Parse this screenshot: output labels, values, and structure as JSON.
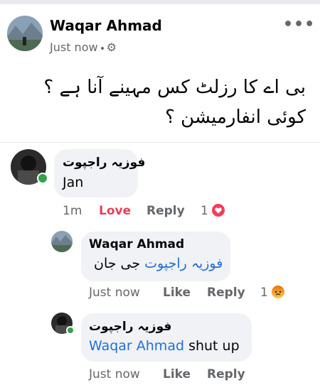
{
  "post": {
    "author": "Waqar Ahmad",
    "time": "Just now",
    "privacy_icon": "gear-icon",
    "more_icon": "more-dots-icon",
    "text_line1": "بی اے کا رزلٹ کس مہینے آنا ہے ؟",
    "text_line2": "کوئی انفارمیشن ؟"
  },
  "comments": [
    {
      "author": "فوزیہ راجپوت",
      "text": "Jan",
      "time": "1m",
      "like_label": "Love",
      "reply_label": "Reply",
      "reaction_count": "1",
      "reaction_icon": "love-reaction-icon",
      "online": true
    },
    {
      "author": "Waqar Ahmad",
      "mention": "فوزیہ راجپوت",
      "text": "جی جان",
      "time": "Just now",
      "like_label": "Like",
      "reply_label": "Reply",
      "reaction_count": "1",
      "reaction_icon": "angry-reaction-icon"
    },
    {
      "author": "فوزیہ راجپوت",
      "mention": "Waqar Ahmad",
      "text": "shut up",
      "time": "Just now",
      "like_label": "Like",
      "reply_label": "Reply",
      "online": true
    }
  ],
  "colors": {
    "mention": "#216fdb",
    "love": "#e4405f",
    "online": "#31a24c"
  }
}
